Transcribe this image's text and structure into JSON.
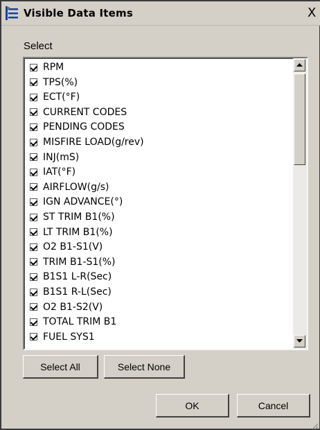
{
  "window": {
    "title": "Visible Data Items",
    "close_glyph": "X",
    "icon": "wrench-icon"
  },
  "select_label": "Select",
  "items": [
    {
      "label": "RPM",
      "checked": true
    },
    {
      "label": "TPS(%)",
      "checked": true
    },
    {
      "label": "ECT(°F)",
      "checked": true
    },
    {
      "label": "CURRENT CODES",
      "checked": true
    },
    {
      "label": "PENDING CODES",
      "checked": true
    },
    {
      "label": "MISFIRE LOAD(g/rev)",
      "checked": true
    },
    {
      "label": "INJ(mS)",
      "checked": true
    },
    {
      "label": "IAT(°F)",
      "checked": true
    },
    {
      "label": "AIRFLOW(g/s)",
      "checked": true
    },
    {
      "label": "IGN ADVANCE(°)",
      "checked": true
    },
    {
      "label": "ST TRIM B1(%)",
      "checked": true
    },
    {
      "label": "LT TRIM B1(%)",
      "checked": true
    },
    {
      "label": "O2 B1-S1(V)",
      "checked": true
    },
    {
      "label": "TRIM B1-S1(%)",
      "checked": true
    },
    {
      "label": "B1S1 L-R(Sec)",
      "checked": true
    },
    {
      "label": "B1S1 R-L(Sec)",
      "checked": true
    },
    {
      "label": "O2 B1-S2(V)",
      "checked": true
    },
    {
      "label": "TOTAL TRIM B1",
      "checked": true
    },
    {
      "label": "FUEL SYS1",
      "checked": true
    }
  ],
  "buttons": {
    "select_all": "Select All",
    "select_none": "Select None",
    "ok": "OK",
    "cancel": "Cancel"
  },
  "colors": {
    "dialog_bg": "#d4d0c8",
    "list_bg": "#ffffff"
  }
}
